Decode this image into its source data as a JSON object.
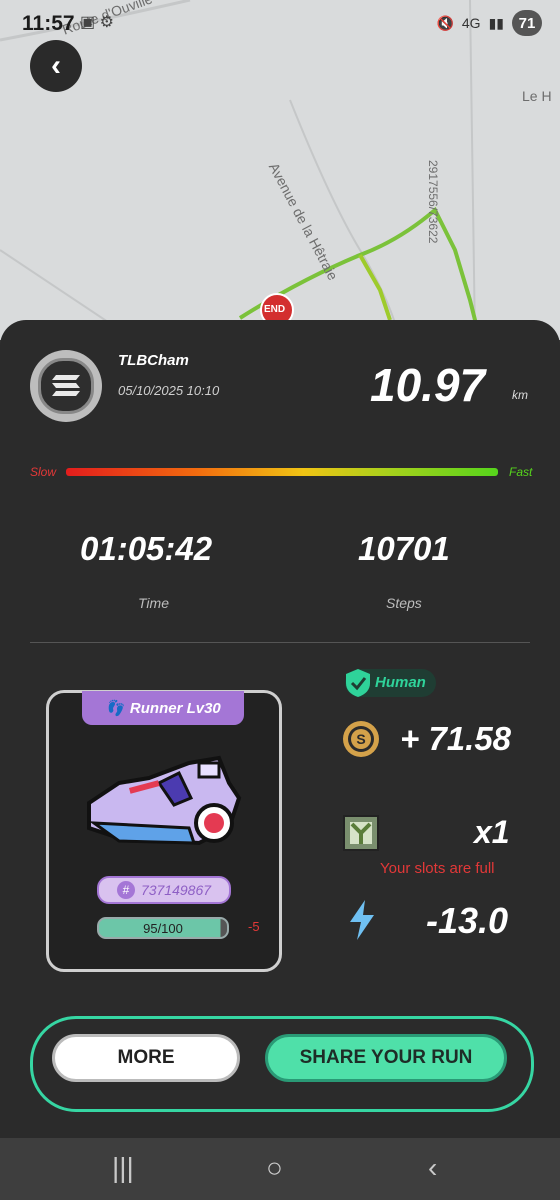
{
  "status_bar": {
    "time": "11:57",
    "network": "4G",
    "battery": "71"
  },
  "map": {
    "road_labels": [
      "Route d'Ouville",
      "Avenue de la Hêtraie",
      "Le H"
    ],
    "side_code": "2917556/73622",
    "end_marker": "END"
  },
  "run": {
    "username": "TLBCham",
    "datetime": "05/10/2025 10:10",
    "distance": "10.97",
    "distance_unit": "km",
    "speed_slow_label": "Slow",
    "speed_fast_label": "Fast",
    "duration": "01:05:42",
    "duration_label": "Time",
    "steps": "10701",
    "steps_label": "Steps"
  },
  "shoe": {
    "title": "Runner Lv30",
    "id": "737149867",
    "durability": "95/100",
    "durability_fraction": 0.95,
    "durability_change": "-5"
  },
  "rewards": {
    "verification": "Human",
    "token_reward": "+ 71.58",
    "mystery_box_count": "x1",
    "slots_message": "Your slots are full",
    "energy_used": "-13.0"
  },
  "actions": {
    "more_label": "MORE",
    "share_label": "SHARE YOUR RUN"
  },
  "colors": {
    "accent_green": "#4fe0a9",
    "panel_bg": "#2b2b2b",
    "runner_purple": "#a476d6",
    "warning_red": "#e23838"
  }
}
